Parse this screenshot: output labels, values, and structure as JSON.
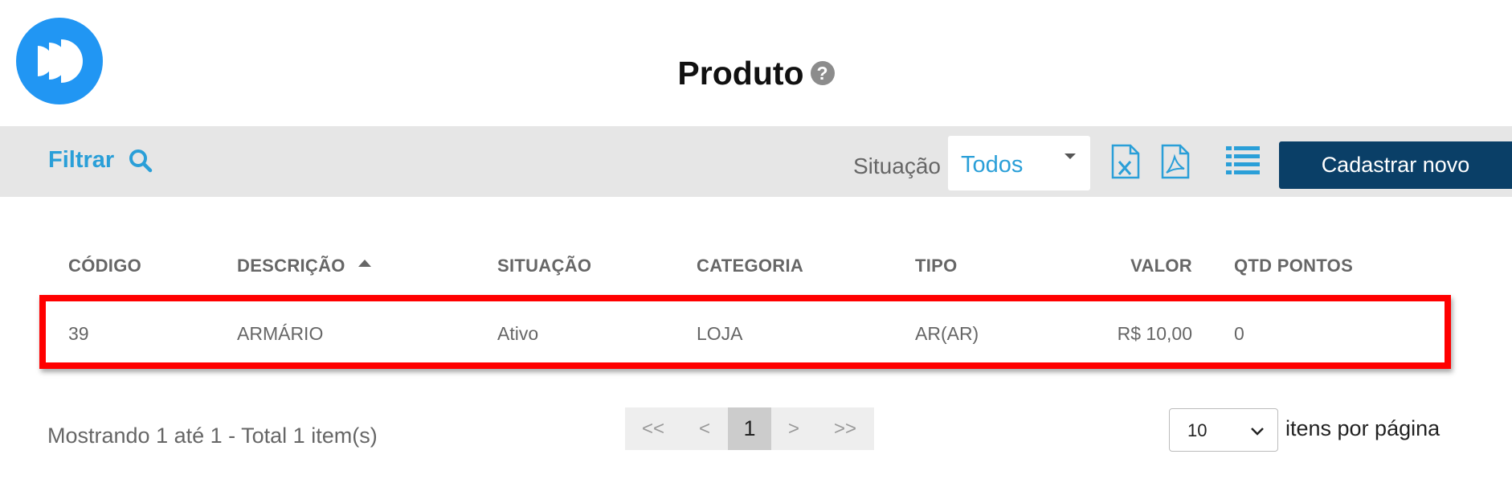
{
  "header": {
    "title": "Produto",
    "help_glyph": "?",
    "logo_icon": "fast-forward-logo-icon",
    "brand_color": "#2196f3"
  },
  "toolbar": {
    "filter_label": "Filtrar",
    "filter_icon": "search-icon",
    "situacao_label": "Situação",
    "situacao_value": "Todos",
    "export_excel_icon": "excel-file-icon",
    "export_pdf_icon": "pdf-file-icon",
    "list_view_icon": "list-icon",
    "new_button_label": "Cadastrar novo",
    "accent_color": "#2a9fd8",
    "button_color": "#0a3f67"
  },
  "table": {
    "columns": [
      "CÓDIGO",
      "DESCRIÇÃO",
      "SITUAÇÃO",
      "CATEGORIA",
      "TIPO",
      "VALOR",
      "QTD PONTOS"
    ],
    "sorted_by": "DESCRIÇÃO",
    "sort_direction": "asc",
    "rows": [
      [
        "39",
        "ARMÁRIO",
        "Ativo",
        "LOJA",
        "AR(AR)",
        "R$ 10,00",
        "0"
      ]
    ],
    "highlight_color": "#ff0000"
  },
  "footer": {
    "showing_text": "Mostrando 1 até 1 - Total 1 item(s)",
    "pager": {
      "first": "<<",
      "prev": "<",
      "current": "1",
      "next": ">",
      "last": ">>"
    },
    "per_page_value": "10",
    "per_page_label": "itens por página"
  }
}
